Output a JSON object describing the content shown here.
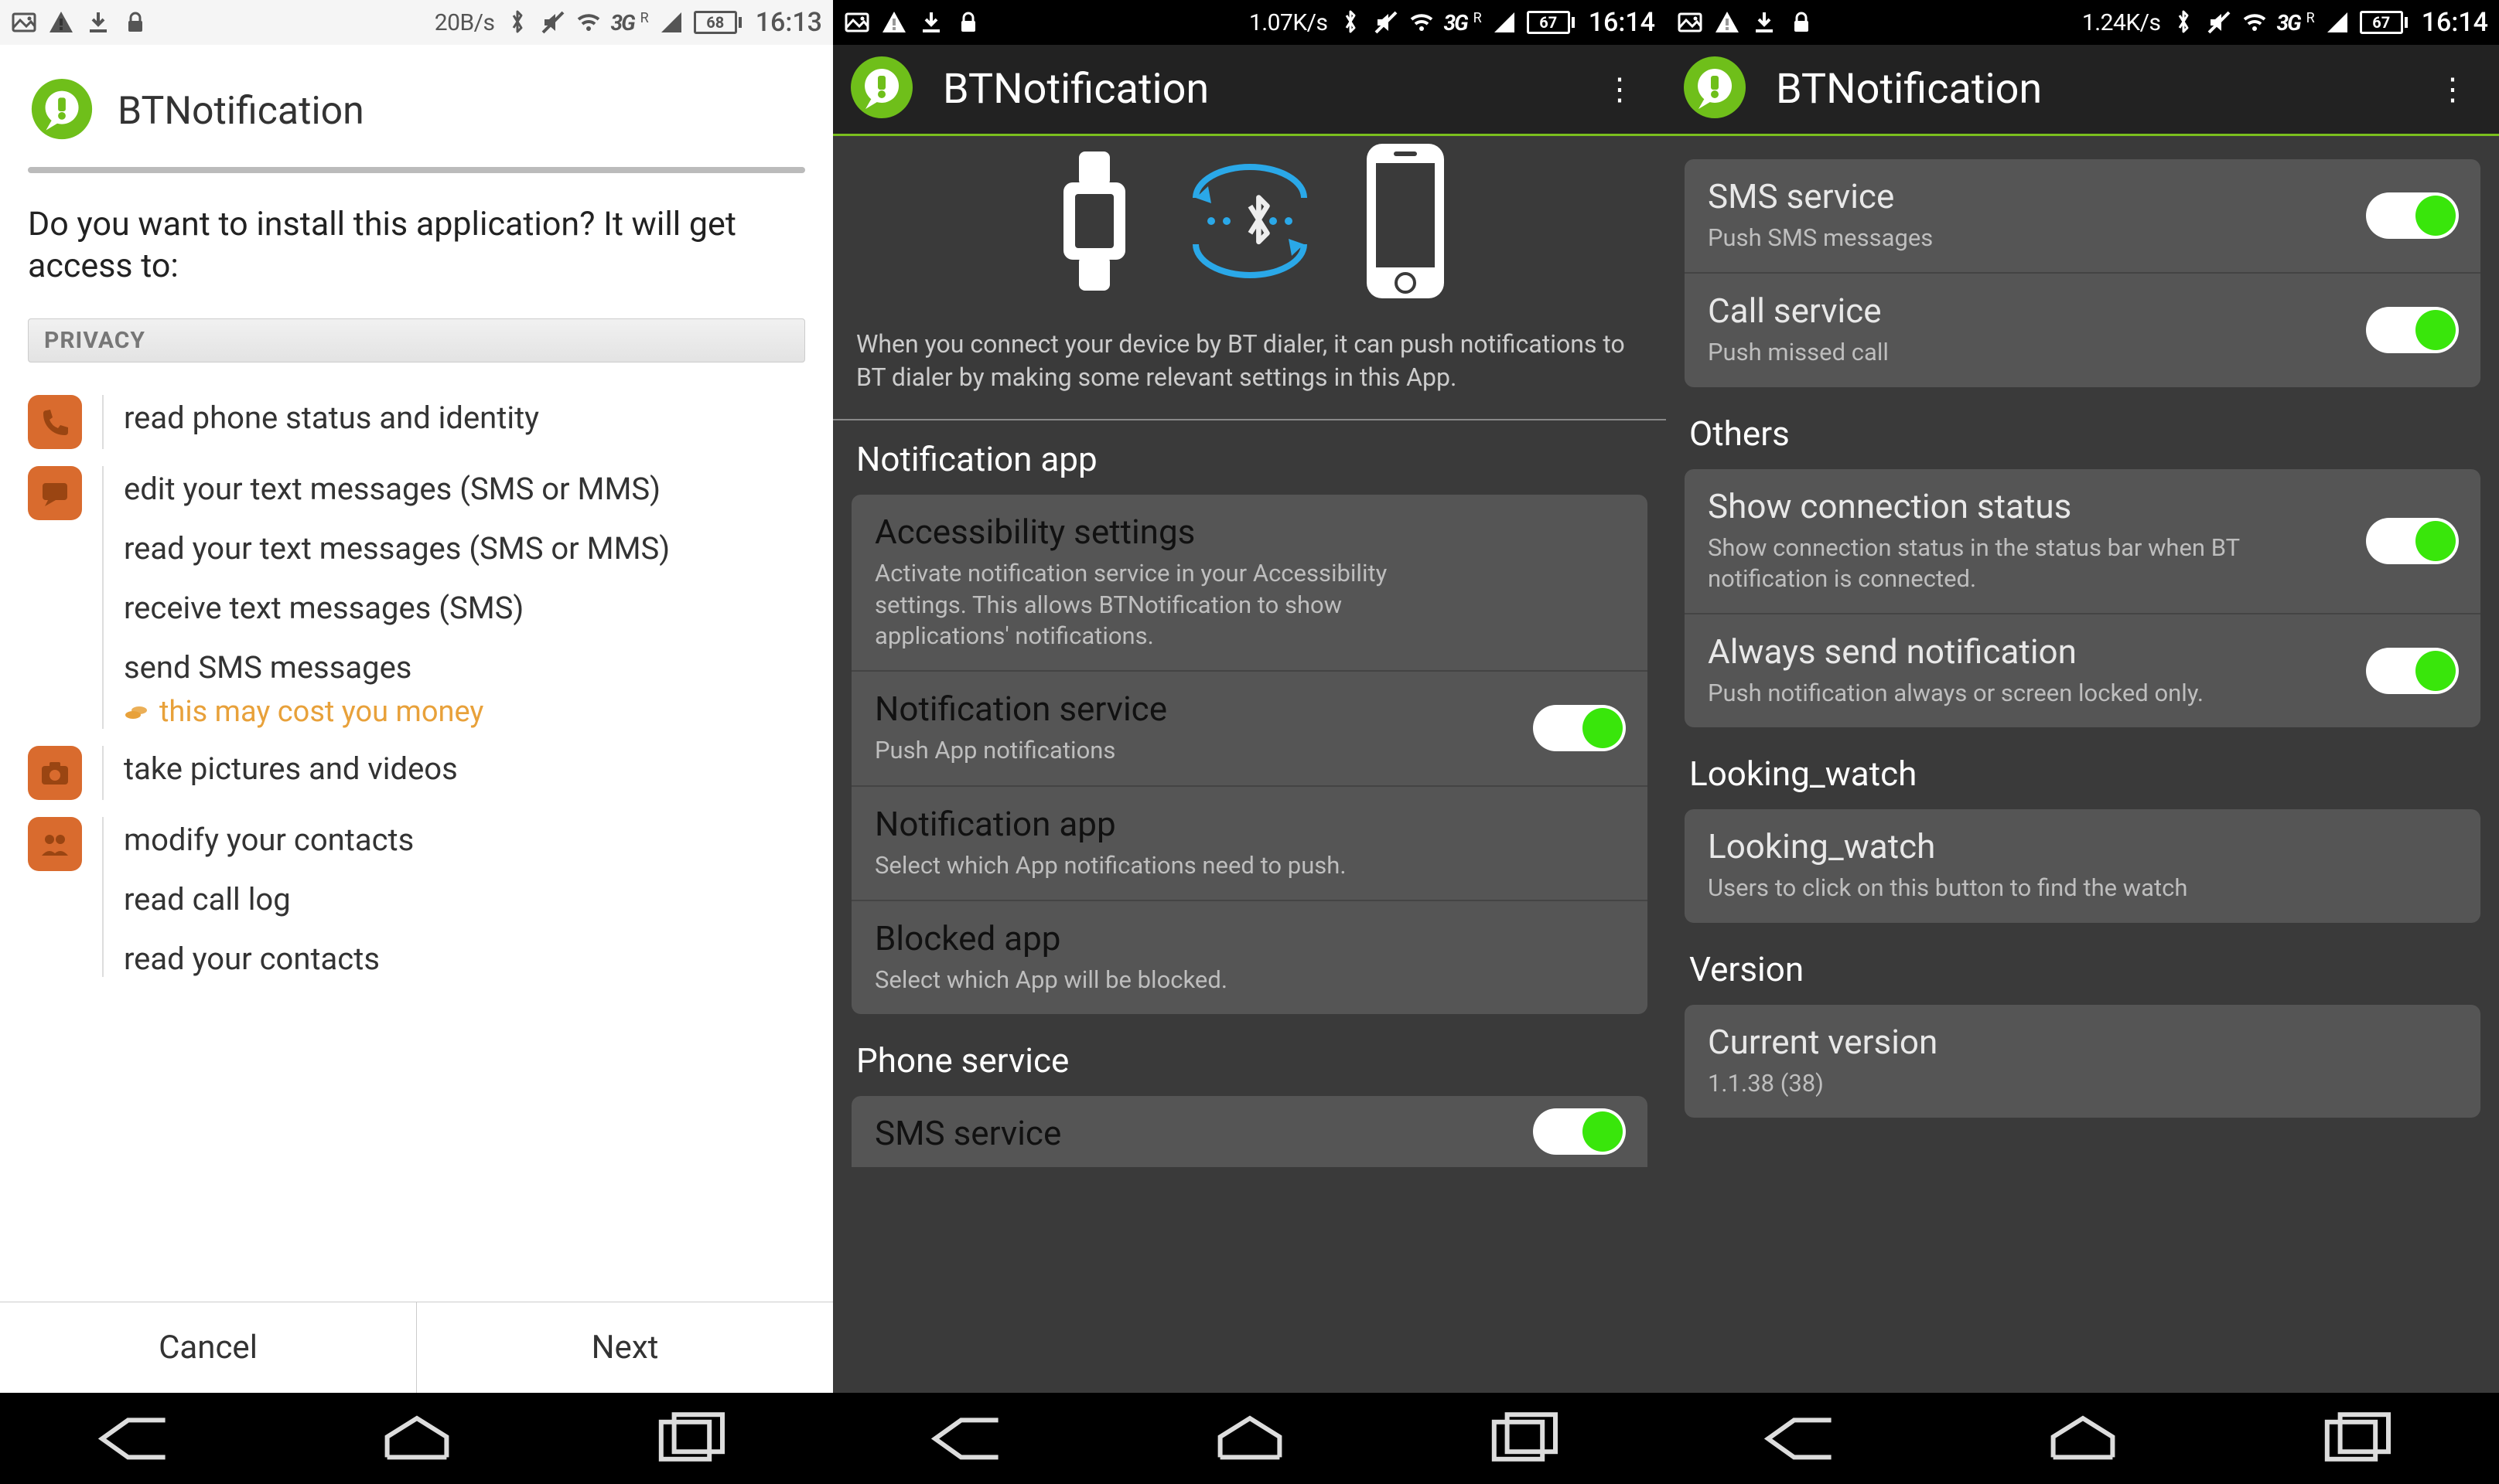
{
  "status": {
    "s1": {
      "speed": "20B/s",
      "battery": "68",
      "time": "16:13"
    },
    "s2": {
      "speed": "1.07K/s",
      "battery": "67",
      "time": "16:14"
    },
    "s3": {
      "speed": "1.24K/s",
      "battery": "67",
      "time": "16:14"
    },
    "net": "3G",
    "roam": "R"
  },
  "install": {
    "app_name": "BTNotification",
    "question": "Do you want to install this application? It will get access to:",
    "section": "PRIVACY",
    "groups": [
      {
        "icon": "phone",
        "lines": [
          "read phone status and identity"
        ]
      },
      {
        "icon": "sms",
        "lines": [
          "edit your text messages (SMS or MMS)",
          "read your text messages (SMS or MMS)",
          "receive text messages (SMS)",
          "send SMS messages"
        ],
        "warn": "this may cost you money"
      },
      {
        "icon": "camera",
        "lines": [
          "take pictures and videos"
        ]
      },
      {
        "icon": "contacts",
        "lines": [
          "modify your contacts",
          "read call log",
          "read your contacts"
        ]
      }
    ],
    "cancel": "Cancel",
    "next": "Next"
  },
  "settings": {
    "title": "BTNotification",
    "hero": "When you connect your device by BT dialer, it can push notifications to BT dialer by making some relevant settings in this App.",
    "sect_notif": "Notification app",
    "acc_t": "Accessibility settings",
    "acc_s": "Activate notification service in your Accessibility settings. This allows BTNotification to show applications' notifications.",
    "nsvc_t": "Notification service",
    "nsvc_s": "Push App notifications",
    "napp_t": "Notification app",
    "napp_s": "Select which App notifications need to push.",
    "blk_t": "Blocked app",
    "blk_s": "Select which App will be blocked.",
    "sect_phone": "Phone service",
    "sms_t": "SMS service",
    "sms_s": "Push SMS messages",
    "call_t": "Call service",
    "call_s": "Push missed call",
    "sect_others": "Others",
    "conn_t": "Show connection status",
    "conn_s": "Show connection status in the status bar when BT notification is connected.",
    "always_t": "Always send notification",
    "always_s": "Push notification always or screen locked only.",
    "sect_look": "Looking_watch",
    "look_t": "Looking_watch",
    "look_s": "Users to click on this button to find the watch",
    "sect_ver": "Version",
    "ver_t": "Current version",
    "ver_s": "1.1.38 (38)"
  }
}
